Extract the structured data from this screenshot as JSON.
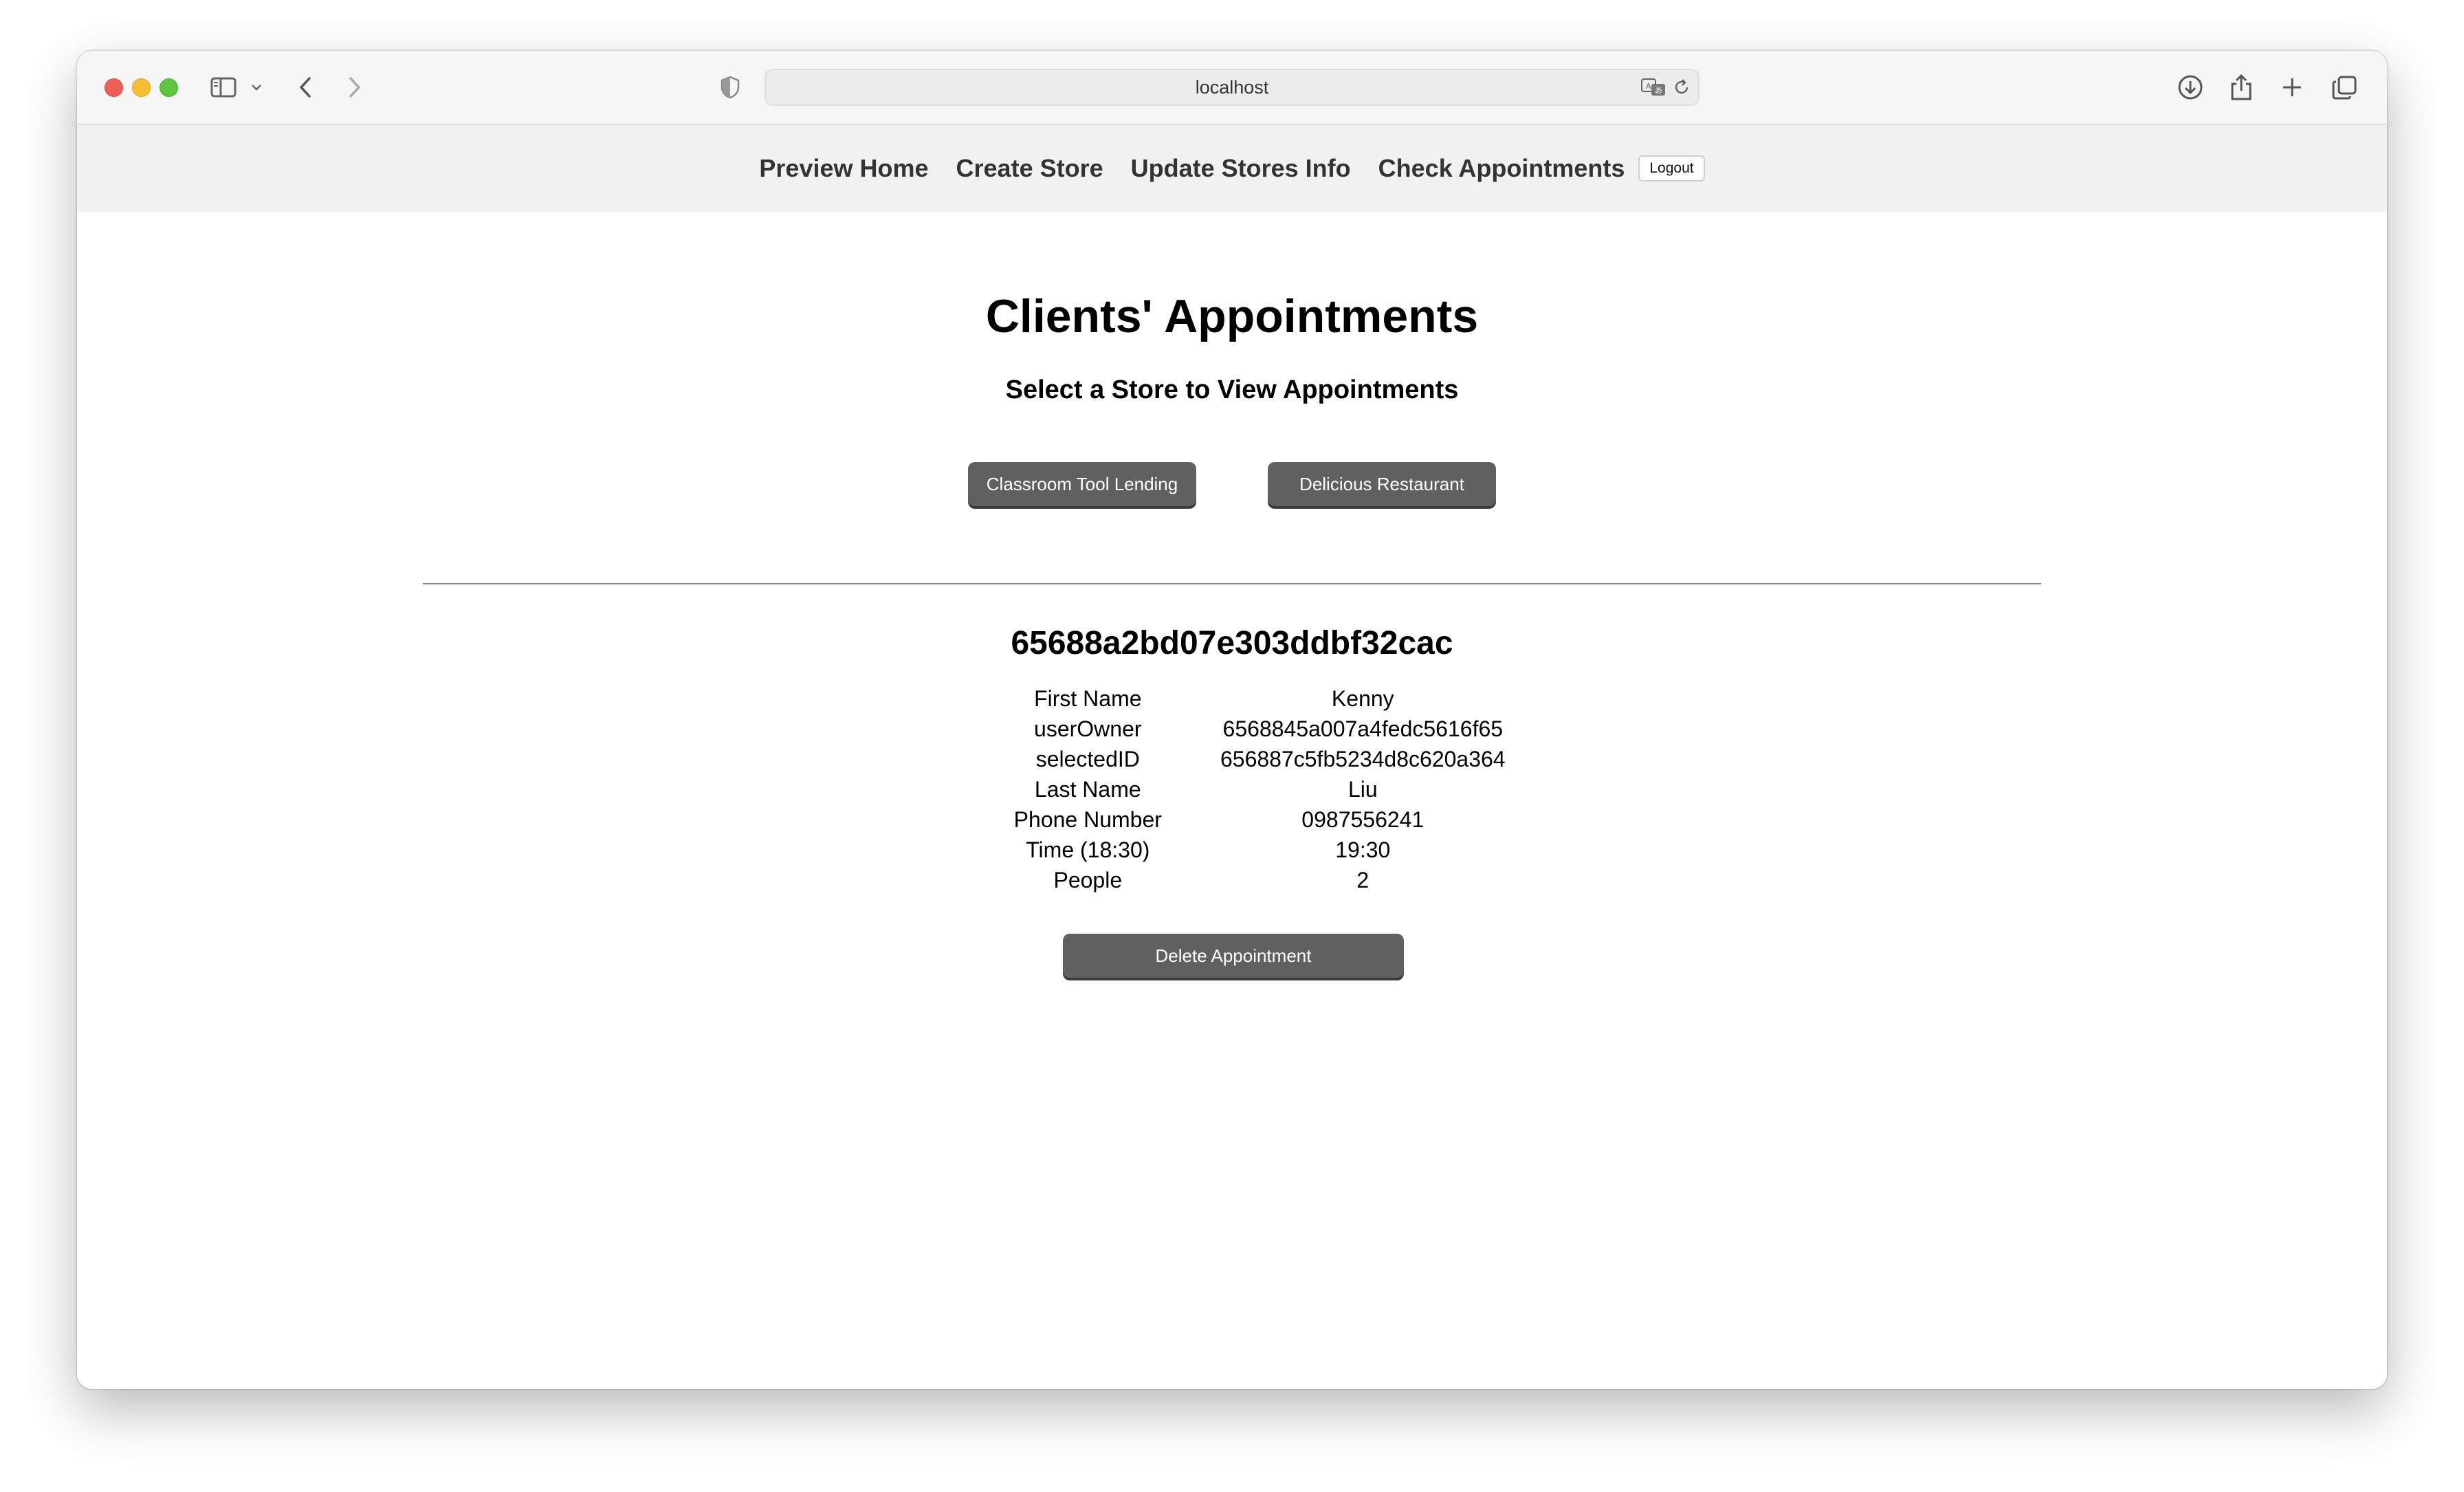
{
  "browser": {
    "url": "localhost",
    "icons": [
      "sidebar-icon",
      "chevron-down-icon",
      "back-icon",
      "forward-icon",
      "shield-icon",
      "translate-icon",
      "reload-icon",
      "download-icon",
      "share-icon",
      "new-tab-icon",
      "tab-overview-icon"
    ]
  },
  "nav": {
    "preview_home": "Preview Home",
    "create_store": "Create Store",
    "update_stores": "Update Stores Info",
    "check_appointments": "Check Appointments",
    "logout": "Logout"
  },
  "page": {
    "title": "Clients' Appointments",
    "subtitle": "Select a Store to View Appointments"
  },
  "stores": [
    {
      "label": "Classroom Tool Lending"
    },
    {
      "label": "Delicious Restaurant"
    }
  ],
  "appointment": {
    "id": "65688a2bd07e303ddbf32cac",
    "fields": [
      {
        "label": "First Name",
        "value": "Kenny"
      },
      {
        "label": "userOwner",
        "value": "6568845a007a4fedc5616f65"
      },
      {
        "label": "selectedID",
        "value": "656887c5fb5234d8c620a364"
      },
      {
        "label": "Last Name",
        "value": "Liu"
      },
      {
        "label": "Phone Number",
        "value": "0987556241"
      },
      {
        "label": "Time (18:30)",
        "value": "19:30"
      },
      {
        "label": "People",
        "value": "2"
      }
    ],
    "delete_label": "Delete Appointment"
  },
  "colors": {
    "button_bg": "#606060",
    "nav_bg": "#f1f1f1",
    "toolbar_bg": "#f6f6f6"
  }
}
